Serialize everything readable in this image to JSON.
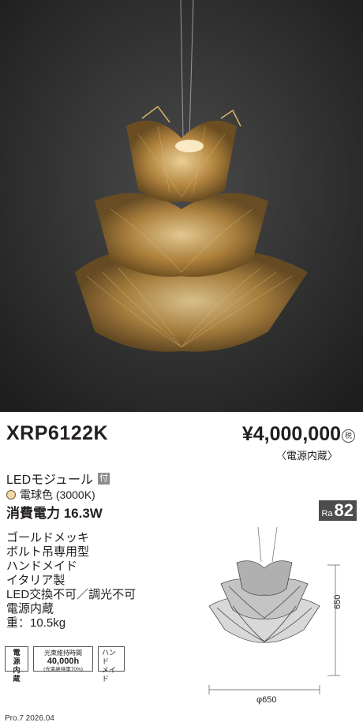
{
  "product": {
    "model": "XRP6122K",
    "price": "¥4,000,000",
    "tax_mark": "税",
    "price_note": "〈電源内蔵〉",
    "light_source": "LEDモジュール",
    "light_source_tag": "付",
    "color": "電球色 (3000K)",
    "power": "消費電力 16.3W",
    "ra_label": "Ra",
    "ra_value": "82"
  },
  "features": [
    "ゴールドメッキ",
    "ボルト吊専用型",
    "ハンドメイド",
    "イタリア製",
    "LED交換不可／調光不可",
    "電源内蔵",
    "重：10.5kg"
  ],
  "icons": {
    "power": [
      "電　源",
      "内　蔵"
    ],
    "lifetime_title": "光束維持時間",
    "lifetime_value": "40,000h",
    "lifetime_note": "(光束維持率70%)",
    "handmade": [
      "ハンド",
      "メイド"
    ]
  },
  "dimensions": {
    "height": "650",
    "diameter": "φ650"
  },
  "footer": "Pro.7 2026.04",
  "colors": {
    "photo_background": "#2a2a2a",
    "gold": "#c9a35a",
    "ra_badge": "#4d4d4d"
  }
}
